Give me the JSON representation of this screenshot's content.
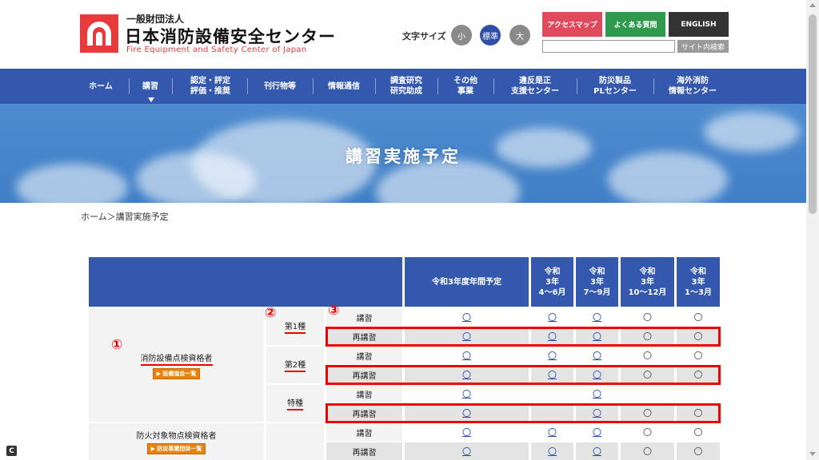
{
  "header": {
    "org_type": "一般財団法人",
    "org_name": "日本消防設備安全センター",
    "org_name_en": "Fire Equipment and Safety Center of Japan",
    "font_size_label": "文字サイズ",
    "font_sizes": [
      "小",
      "標準",
      "大"
    ],
    "buttons": {
      "access": "アクセスマップ",
      "faq": "よくある質問",
      "english": "ENGLISH"
    },
    "search_placeholder": "",
    "search_button": "サイト内検索",
    "colors": {
      "brand_red": "#e83a3a",
      "nav_blue": "#3358ad",
      "access": "#e04a5c",
      "faq": "#2f9a4c"
    }
  },
  "nav": {
    "items": [
      "ホーム",
      "講習",
      "認定・評定\n評価・推奨",
      "刊行物等",
      "情報通信",
      "調査研究\n研究助成",
      "その他\n事業",
      "違反是正\n支援センター",
      "防災製品\nPLセンター",
      "海外消防\n情報センター"
    ]
  },
  "hero": {
    "title": "講習実施予定"
  },
  "breadcrumb": "ホーム＞講習実施予定",
  "table": {
    "headers": {
      "annual": "令和3年度年間予定",
      "q1": "令和\n3年\n4〜6月",
      "q2": "令和\n3年\n7〜9月",
      "q3": "令和\n3年\n10〜12月",
      "q4": "令和\n3年\n1〜3月"
    },
    "qualifications": [
      {
        "name": "消防設備点検資格者",
        "badge": "▶ 設備協会一覧"
      },
      {
        "name": "防火対象物点検資格者",
        "badge": "▶ 防災事業団体一覧"
      }
    ],
    "classes": [
      "第1種",
      "第2種",
      "特種"
    ],
    "types": {
      "course": "講習",
      "recourse": "再講習"
    },
    "circle": "〇",
    "annotations": [
      "①",
      "②",
      "③"
    ]
  }
}
